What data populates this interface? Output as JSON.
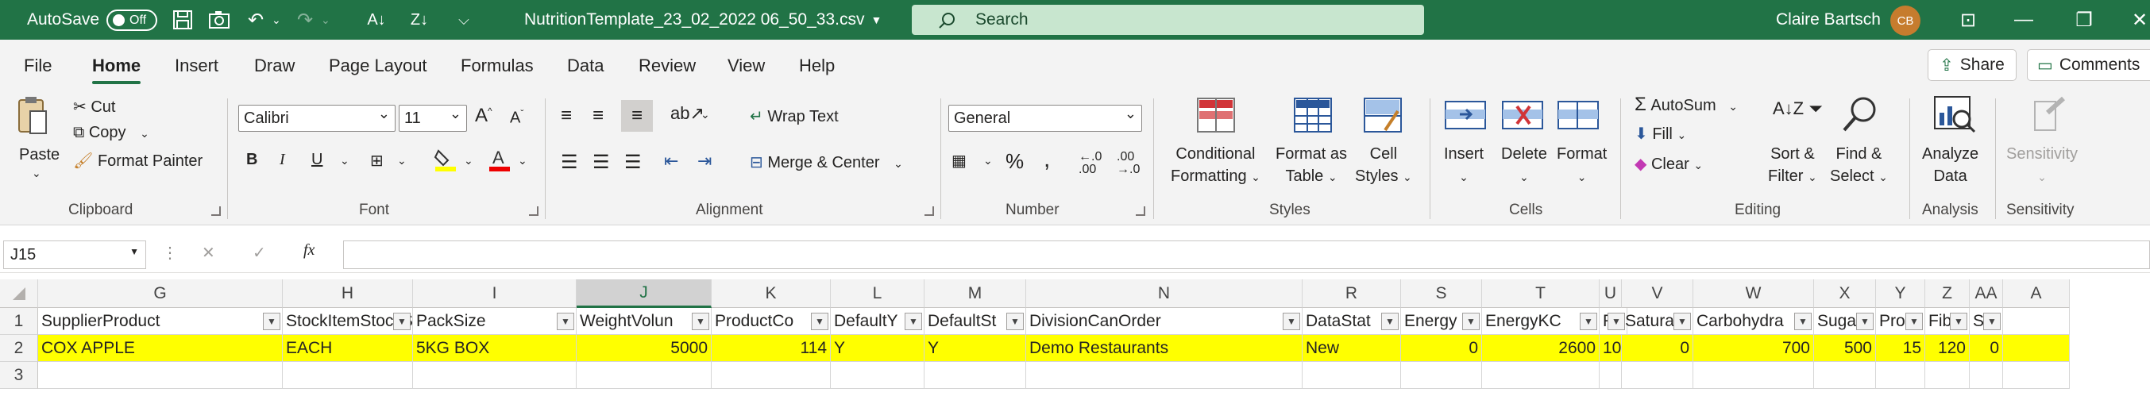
{
  "titlebar": {
    "autosave_label": "AutoSave",
    "autosave_state": "Off",
    "filename": "NutritionTemplate_23_02_2022 06_50_33.csv",
    "search_placeholder": "Search",
    "user_name": "Claire Bartsch",
    "user_initials": "CB"
  },
  "menu": {
    "items": [
      "File",
      "Home",
      "Insert",
      "Draw",
      "Page Layout",
      "Formulas",
      "Data",
      "Review",
      "View",
      "Help"
    ],
    "active": "Home",
    "share": "Share",
    "comments": "Comments"
  },
  "ribbon": {
    "clipboard": {
      "paste": "Paste",
      "cut": "Cut",
      "copy": "Copy",
      "format_painter": "Format Painter",
      "label": "Clipboard"
    },
    "font": {
      "name": "Calibri",
      "size": "11",
      "label": "Font",
      "bold": "B",
      "italic": "I",
      "underline": "U"
    },
    "alignment": {
      "wrap_text": "Wrap Text",
      "merge_center": "Merge & Center",
      "label": "Alignment"
    },
    "number": {
      "format": "General",
      "label": "Number"
    },
    "styles": {
      "conditional": "Conditional",
      "conditional2": "Formatting",
      "format_table": "Format as",
      "format_table2": "Table",
      "cell_styles": "Cell",
      "cell_styles2": "Styles",
      "label": "Styles"
    },
    "cells": {
      "insert": "Insert",
      "delete": "Delete",
      "format": "Format",
      "label": "Cells"
    },
    "editing": {
      "autosum": "AutoSum",
      "fill": "Fill",
      "clear": "Clear",
      "sort": "Sort &",
      "sort2": "Filter",
      "find": "Find &",
      "find2": "Select",
      "label": "Editing"
    },
    "analysis": {
      "analyze": "Analyze",
      "analyze2": "Data",
      "label": "Analysis"
    },
    "sensitivity": {
      "btn": "Sensitivity",
      "label": "Sensitivity"
    }
  },
  "formula_bar": {
    "name_box": "J15",
    "fx": "fx",
    "content": ""
  },
  "grid": {
    "selected_column": "J",
    "columns": [
      "G",
      "H",
      "I",
      "J",
      "K",
      "L",
      "M",
      "N",
      "R",
      "S",
      "T",
      "U",
      "V",
      "W",
      "X",
      "Y",
      "Z",
      "AA",
      "A"
    ],
    "rows": [
      "1",
      "2",
      "3"
    ],
    "header_row": [
      "SupplierProduct",
      "StockItemStockSi",
      "PackSize",
      "WeightVolun",
      "ProductCo",
      "DefaultY",
      "DefaultSt",
      "DivisionCanOrder",
      "DataStat",
      "Energy",
      "EnergyKC",
      "F",
      "Saturat",
      "Carbohydra",
      "Suga",
      "Prote",
      "Fib",
      "Sa",
      ""
    ],
    "data_row": [
      "COX APPLE",
      "EACH",
      "5KG BOX",
      "5000",
      "114",
      "Y",
      "Y",
      "Demo Restaurants",
      "New",
      "0",
      "2600",
      "10",
      "0",
      "700",
      "500",
      "15",
      "120",
      "0",
      ""
    ]
  }
}
